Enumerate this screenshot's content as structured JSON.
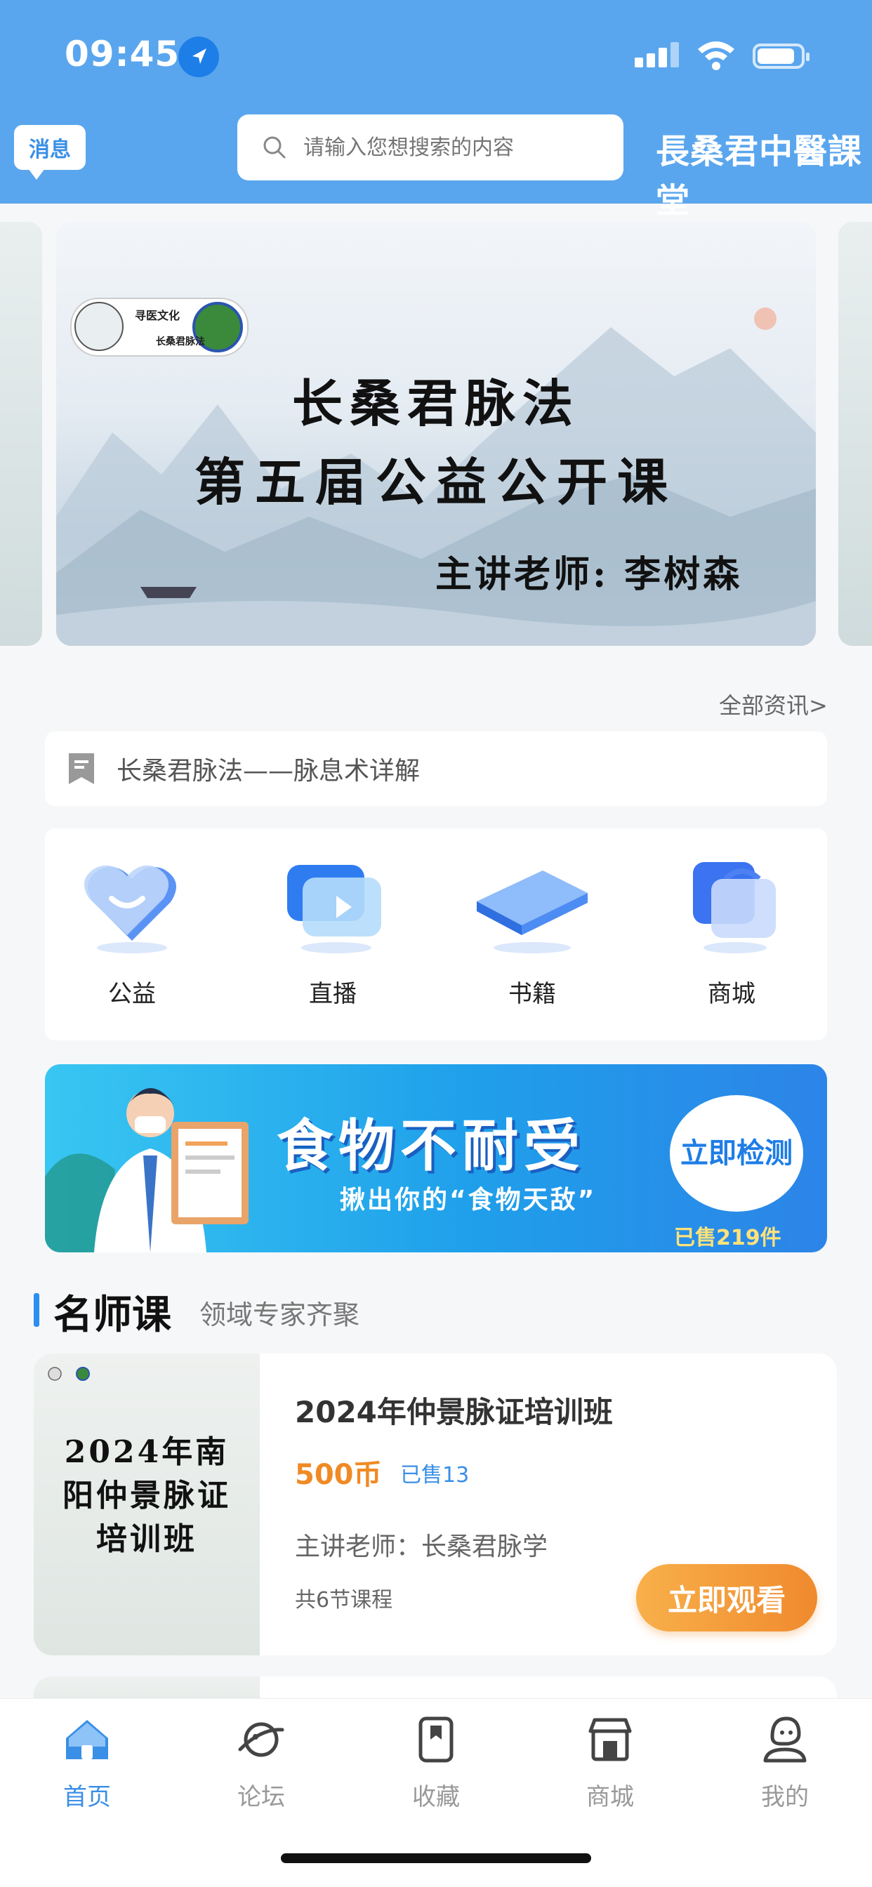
{
  "status_bar": {
    "time": "09:45"
  },
  "header": {
    "message_label": "消息",
    "search_placeholder": "请输入您想搜索的内容",
    "brand": "長桑君中醫課堂"
  },
  "banner": {
    "logo_text_1": "寻医文化",
    "logo_text_2": "长桑君脉法",
    "title_line1": "长桑君脉法",
    "title_line2": "第五届公益公开课",
    "speaker": "主讲老师:  李树森"
  },
  "news": {
    "all_link": "全部资讯>",
    "headline": "长桑君脉法——脉息术详解"
  },
  "categories": [
    {
      "label": "公益",
      "icon": "heart-icon"
    },
    {
      "label": "直播",
      "icon": "live-play-icon"
    },
    {
      "label": "书籍",
      "icon": "book-icon"
    },
    {
      "label": "商城",
      "icon": "shopping-bag-icon"
    }
  ],
  "ad": {
    "title": "食物不耐受",
    "subtitle": "揪出你的“食物天敌”",
    "button": "立即检测",
    "sold": "已售219件"
  },
  "section": {
    "title": "名师课",
    "subtitle": "领域专家齐聚"
  },
  "course": {
    "thumb_text": "2024年南阳仲景脉证培训班",
    "title": "2024年仲景脉证培训班",
    "price": "500币",
    "sold": "已售13",
    "teacher": "主讲老师：长桑君脉学",
    "lessons": "共6节课程",
    "button": "立即观看"
  },
  "tabbar": [
    {
      "label": "首页",
      "icon": "home-icon",
      "active": true
    },
    {
      "label": "论坛",
      "icon": "planet-icon",
      "active": false
    },
    {
      "label": "收藏",
      "icon": "bookmark-icon",
      "active": false
    },
    {
      "label": "商城",
      "icon": "store-icon",
      "active": false
    },
    {
      "label": "我的",
      "icon": "profile-icon",
      "active": false
    }
  ],
  "colors": {
    "primary": "#5aa6ee",
    "accent_blue": "#3a8fe6",
    "price_orange": "#f08a24"
  }
}
